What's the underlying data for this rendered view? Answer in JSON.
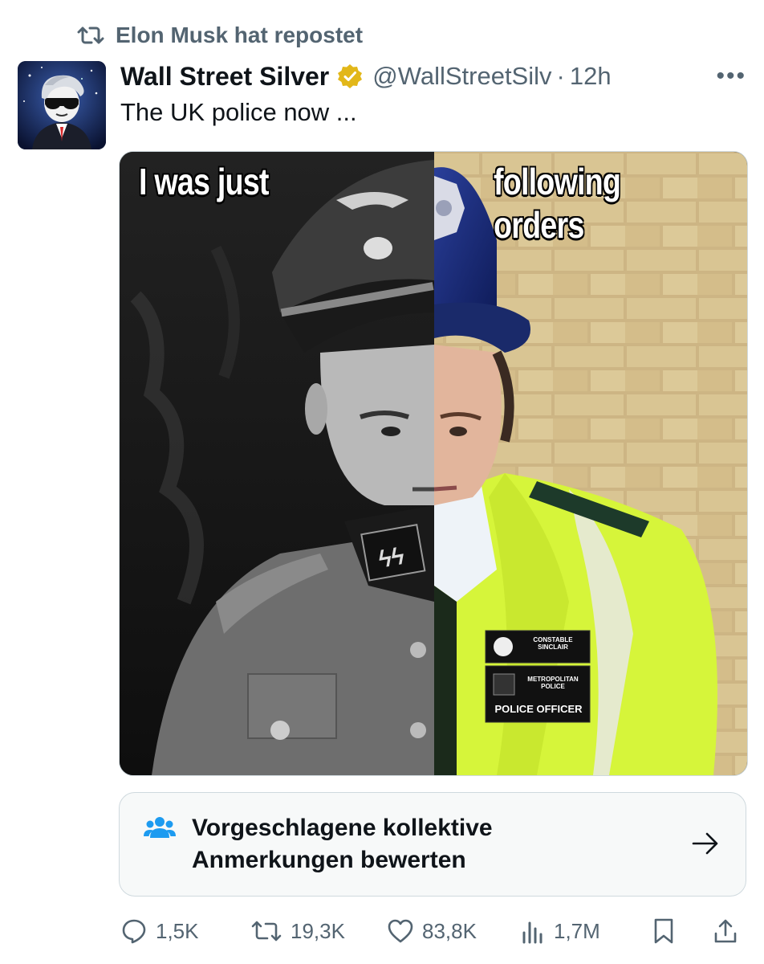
{
  "repost": {
    "text": "Elon Musk hat repostet",
    "icon": "repost-icon"
  },
  "author": {
    "name": "Wall Street Silver",
    "handle": "@WallStreetSilv",
    "separator": "·",
    "time": "12h",
    "verified_color": "#e2b719"
  },
  "tweet": {
    "text": "The UK police now ..."
  },
  "media": {
    "caption_left": "I was just",
    "caption_right": "following orders",
    "badge_name": "CONSTABLE SINCLAIR",
    "badge_org": "METROPOLITAN POLICE",
    "badge_role": "POLICE OFFICER"
  },
  "community_notes": {
    "label": "Vorgeschlagene kollektive Anmerkungen bewerten",
    "accent": "#1d9bf0"
  },
  "actions": {
    "replies": "1,5K",
    "reposts": "19,3K",
    "likes": "83,8K",
    "views": "1,7M"
  },
  "colors": {
    "secondary_text": "#536471",
    "primary_text": "#0f1419"
  }
}
